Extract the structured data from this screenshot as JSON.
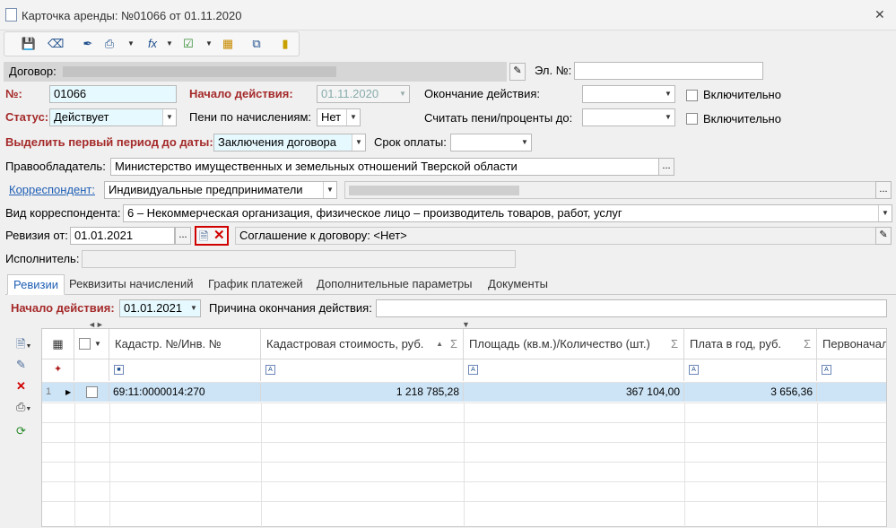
{
  "window": {
    "title": "Карточка аренды: №01066 от 01.11.2020",
    "close": "✕"
  },
  "toolbar": {
    "icons": [
      "save-icon",
      "clear-icon",
      "sign-icon",
      "print-icon",
      "formula-icon",
      "calc-icon",
      "export-icon",
      "copy-icon",
      "book-icon"
    ]
  },
  "form": {
    "contract_label": "Договор:",
    "el_no_label": "Эл. №:",
    "el_no_value": "",
    "no_label": "№:",
    "no_value": "01066",
    "start_label": "Начало действия:",
    "start_value": "01.11.2020",
    "end_label": "Окончание действия:",
    "end_value": "",
    "inclusive_label_1": "Включительно",
    "status_label": "Статус:",
    "status_value": "Действует",
    "penalty_label": "Пени по начислениям:",
    "penalty_value": "Нет",
    "calc_penalty_label": "Считать пени/проценты до:",
    "calc_penalty_value": "",
    "inclusive_label_2": "Включительно",
    "first_period_label": "Выделить первый период до даты:",
    "first_period_value": "Заключения договора",
    "pay_term_label": "Срок оплаты:",
    "pay_term_value": "",
    "owner_label": "Правообладатель:",
    "owner_value": "Министерство имущественных и земельных отношений Тверской области",
    "corr_label": "Корреспондент:",
    "corr_value": "Индивидуальные предприниматели",
    "corr_kind_label": "Вид корреспондента:",
    "corr_kind_value": "6 – Некоммерческая организация, физическое лицо – производитель товаров, работ, услуг",
    "revision_label": "Ревизия от:",
    "revision_value": "01.01.2021",
    "agreement_label": "Соглашение к договору: <Нет>",
    "executor_label": "Исполнитель:",
    "ellipsis": "..."
  },
  "tabs": [
    "Ревизии",
    "Реквизиты начислений",
    "График платежей",
    "Дополнительные параметры",
    "Документы"
  ],
  "revision_tab": {
    "start_label": "Начало действия:",
    "start_value": "01.01.2021",
    "reason_label": "Причина окончания действия:",
    "reason_value": ""
  },
  "grid": {
    "columns": [
      "Кадастр. №/Инв. №",
      "Кадастровая стоимость, руб.",
      "Площадь (кв.м.)/Количество (шт.)",
      "Плата в год, руб.",
      "Первоначал"
    ],
    "rows": [
      {
        "index": "1",
        "cadastre": "69:11:0000014:270",
        "cost": "1 218 785,28",
        "area": "367 104,00",
        "fee": "3 656,36",
        "initial": ""
      }
    ],
    "sigma": "Σ"
  },
  "colors": {
    "accent": "#1f5fb5",
    "required_label": "#a52a2a",
    "selected_row": "#cde4f6",
    "required_field": "#e5f9ff"
  }
}
